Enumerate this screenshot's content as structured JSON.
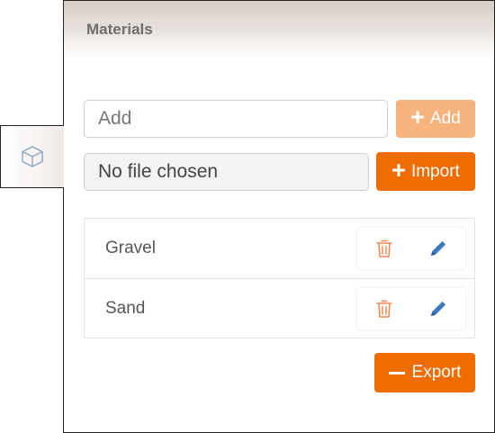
{
  "panel": {
    "title": "Materials"
  },
  "add_row": {
    "input_value": "",
    "input_placeholder": "Add",
    "add_button_label": "Add"
  },
  "import_row": {
    "file_text": "No file chosen",
    "import_button_label": "Import"
  },
  "materials": {
    "items": [
      {
        "label": "Gravel"
      },
      {
        "label": "Sand"
      }
    ]
  },
  "export_button_label": "Export",
  "icons": {
    "side_tab": "cube-icon",
    "delete": "trash-icon",
    "edit": "pencil-icon",
    "plus": "plus-icon",
    "minus": "minus-icon"
  },
  "colors": {
    "accent": "#ef6c00",
    "accent_disabled": "#f7b37e",
    "delete_icon": "#f08a55",
    "edit_icon": "#3a78c2",
    "side_tab_icon": "#8aa6c8"
  }
}
